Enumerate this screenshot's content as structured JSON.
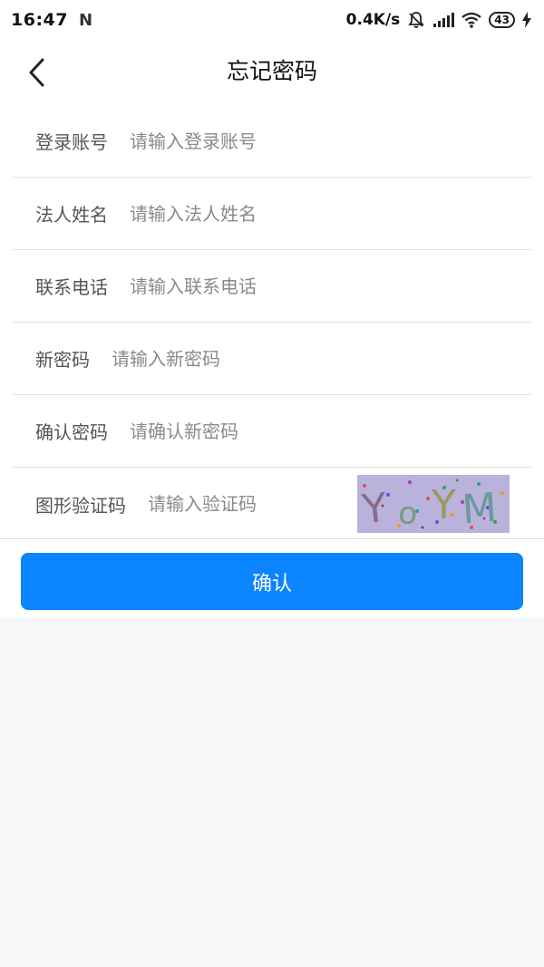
{
  "status_bar": {
    "time": "16:47",
    "notification_icon": "N",
    "network_speed": "0.4K/s",
    "battery": "43"
  },
  "header": {
    "back_icon": "chevron-left-icon",
    "title": "忘记密码"
  },
  "form": {
    "fields": [
      {
        "label": "登录账号",
        "placeholder": "请输入登录账号",
        "value": ""
      },
      {
        "label": "法人姓名",
        "placeholder": "请输入法人姓名",
        "value": ""
      },
      {
        "label": "联系电话",
        "placeholder": "请输入联系电话",
        "value": ""
      },
      {
        "label": "新密码",
        "placeholder": "请输入新密码",
        "value": ""
      },
      {
        "label": "确认密码",
        "placeholder": "请确认新密码",
        "value": ""
      },
      {
        "label": "图形验证码",
        "placeholder": "请输入验证码",
        "value": ""
      }
    ],
    "captcha_text": "YoYM"
  },
  "confirm_button": {
    "label": "确认"
  },
  "colors": {
    "primary": "#0a84ff",
    "page_background": "#f7f7f7",
    "captcha_background": "#b9b2dc"
  }
}
